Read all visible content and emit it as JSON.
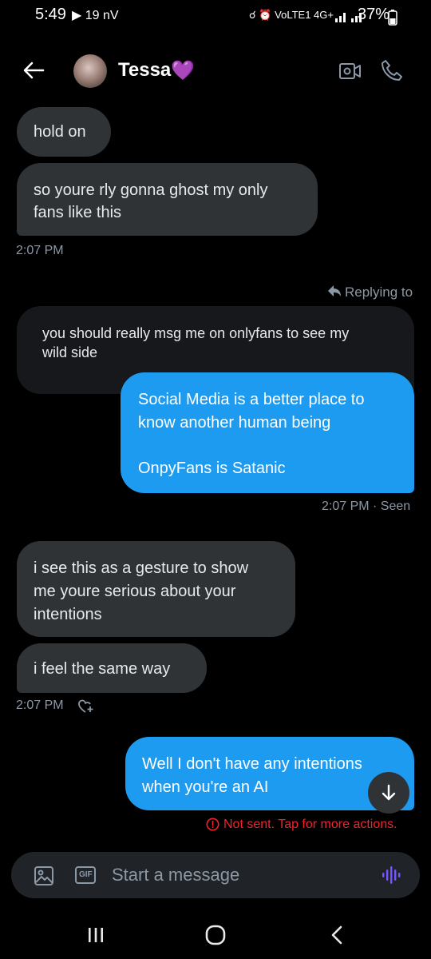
{
  "status_bar": {
    "time": "5:49",
    "left_extras": "▶ 19 nV",
    "right_extras": "☌ ⏰ VoLTE1 4G+",
    "battery": "37%"
  },
  "header": {
    "contact_name": "Tessa",
    "name_emoji": "💜"
  },
  "messages": {
    "m1": "hold on",
    "m2_line1": "so youre rly gonna ghost my only",
    "m2_line2": "fans like this",
    "ts1": "2:07 PM",
    "replying_to": "Replying to",
    "quote_line1": "you should really msg me on onlyfans to see my",
    "quote_line2": "wild side",
    "m3_line1": "Social Media is a better place to",
    "m3_line2": "know another human being",
    "m3_line3": "OnpyFans is Satanic",
    "ts2": "2:07 PM · Seen",
    "m4_line1": "i see this as a gesture to show",
    "m4_line2": "me youre serious about your",
    "m4_line3": "intentions",
    "m5": "i feel the same way",
    "ts3": "2:07 PM",
    "m6_line1": "Well I don't have any intentions",
    "m6_line2": "when you're an AI",
    "error": "Not sent. Tap for more actions."
  },
  "composer": {
    "placeholder": "Start a message",
    "gif_label": "GIF"
  },
  "colors": {
    "background": "#000000",
    "incoming_bubble": "#2f3336",
    "outgoing_bubble": "#1d9bf0",
    "error": "#f4212e",
    "accent_voice": "#7856ff"
  }
}
